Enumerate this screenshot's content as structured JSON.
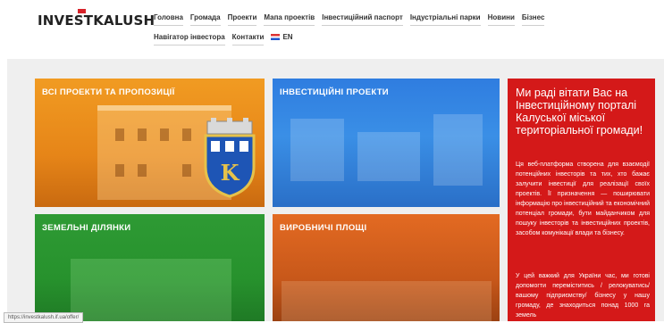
{
  "brand": {
    "logo_text": "INVESTKALUSH"
  },
  "nav": {
    "row1": [
      "Головна",
      "Громада",
      "Проекти",
      "Мапа проектів",
      "Інвестиційний паспорт",
      "Індустріальні парки",
      "Новини",
      "Бізнес"
    ],
    "row2": [
      "Навігатор інвестора",
      "Контакти"
    ],
    "lang": "EN"
  },
  "tiles": {
    "projects": "ВСІ ПРОЕКТИ ТА ПРОПОЗИЦІЇ",
    "investment": "ІНВЕСТИЦІЙНІ ПРОЕКТИ",
    "land": "ЗЕМЕЛЬНІ ДІЛЯНКИ",
    "production": "ВИРОБНИЧІ ПЛОЩІ"
  },
  "welcome": {
    "title": "Ми раді вітати Вас на Інвестиційному порталі Калуської міської територіальної громади!",
    "text": "Ця веб-платформа створена для взаємодії потенційних інвесторів та тих, хто бажає залучити інвестиції для реалізації своїх проектів. Її призначення — поширювати інформацію про інвестиційний та економічний потенціал громади, бути майданчиком для пошуку інвесторів та інвестиційних проектів, засобом комунікації влади та бізнесу.",
    "text2": "У цей важкий для України час, ми готові допомогти переміститись / релокуватись/ вашому підприємству/ бізнесу у нашу громаду, де знаходиться понад 1000 га земель"
  },
  "status_url": "https://investkalush.if.ua/offer/",
  "colors": {
    "accent_red": "#d41919",
    "orange": "#f19b22",
    "blue": "#2f7de0",
    "green": "#2e9a34"
  }
}
